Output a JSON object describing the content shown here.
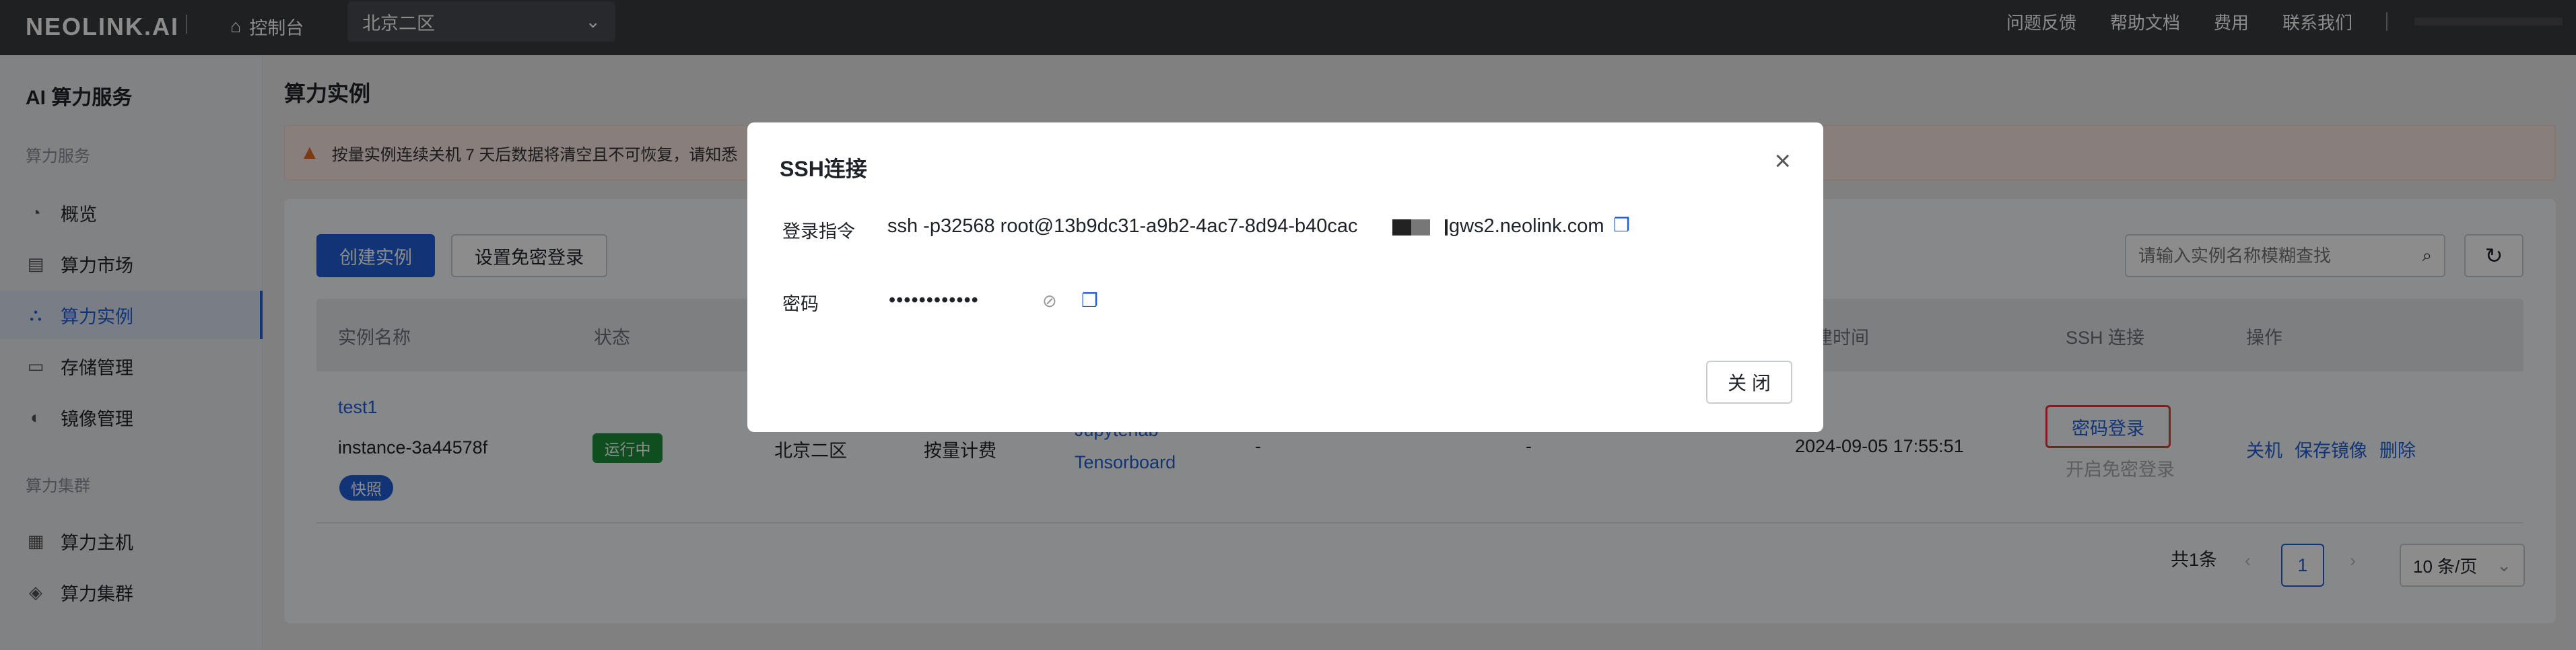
{
  "topbar": {
    "logo": "NEOLINK.AI",
    "home_label": "控制台",
    "region": "北京二区",
    "links": [
      "问题反馈",
      "帮助文档",
      "费用",
      "联系我们"
    ]
  },
  "sidebar": {
    "title": "AI 算力服务",
    "group1": "算力服务",
    "items1": [
      {
        "label": "概览",
        "icon": "dashboard-icon"
      },
      {
        "label": "算力市场",
        "icon": "market-icon"
      },
      {
        "label": "算力实例",
        "icon": "instance-icon",
        "active": true
      },
      {
        "label": "存储管理",
        "icon": "storage-icon"
      },
      {
        "label": "镜像管理",
        "icon": "image-icon"
      }
    ],
    "group2": "算力集群",
    "items2": [
      {
        "label": "算力主机",
        "icon": "host-icon"
      },
      {
        "label": "算力集群",
        "icon": "cluster-icon"
      }
    ]
  },
  "main": {
    "page_title": "算力实例",
    "alert_text": "按量实例连续关机 7 天后数据将清空且不可恢复，请知悉",
    "create_button": "创建实例",
    "passwordless_button": "设置免密登录",
    "search_placeholder": "请输入实例名称模糊查找",
    "table": {
      "headers": [
        "实例名称",
        "状态",
        "创建时间",
        "SSH 连接",
        "操作"
      ],
      "row": {
        "name": "test1",
        "instance_id": "instance-3a44578f",
        "snapshot_badge": "快照",
        "status": "运行中",
        "region": "北京二区",
        "billing": "按量计费",
        "tools": [
          "Jupyterlab",
          "Tensorboard"
        ],
        "dash1": "-",
        "dash2": "-",
        "created": "2024-09-05 17:55:51",
        "ssh_password_login": "密码登录",
        "ssh_passwordless": "开启免密登录",
        "actions": [
          "关机",
          "保存镜像",
          "删除"
        ]
      }
    },
    "pagination": {
      "total": "共1条",
      "current": "1",
      "page_size": "10 条/页"
    }
  },
  "modal": {
    "title": "SSH连接",
    "cmd_label": "登录指令",
    "cmd_value_start": "ssh -p32568 root@13b9dc31-a9b2-4ac7-8d94-b40cac",
    "cmd_value_end": "gws2.neolink.com",
    "pwd_label": "密码",
    "pwd_value": "••••••••••••",
    "close_button": "关 闭"
  }
}
